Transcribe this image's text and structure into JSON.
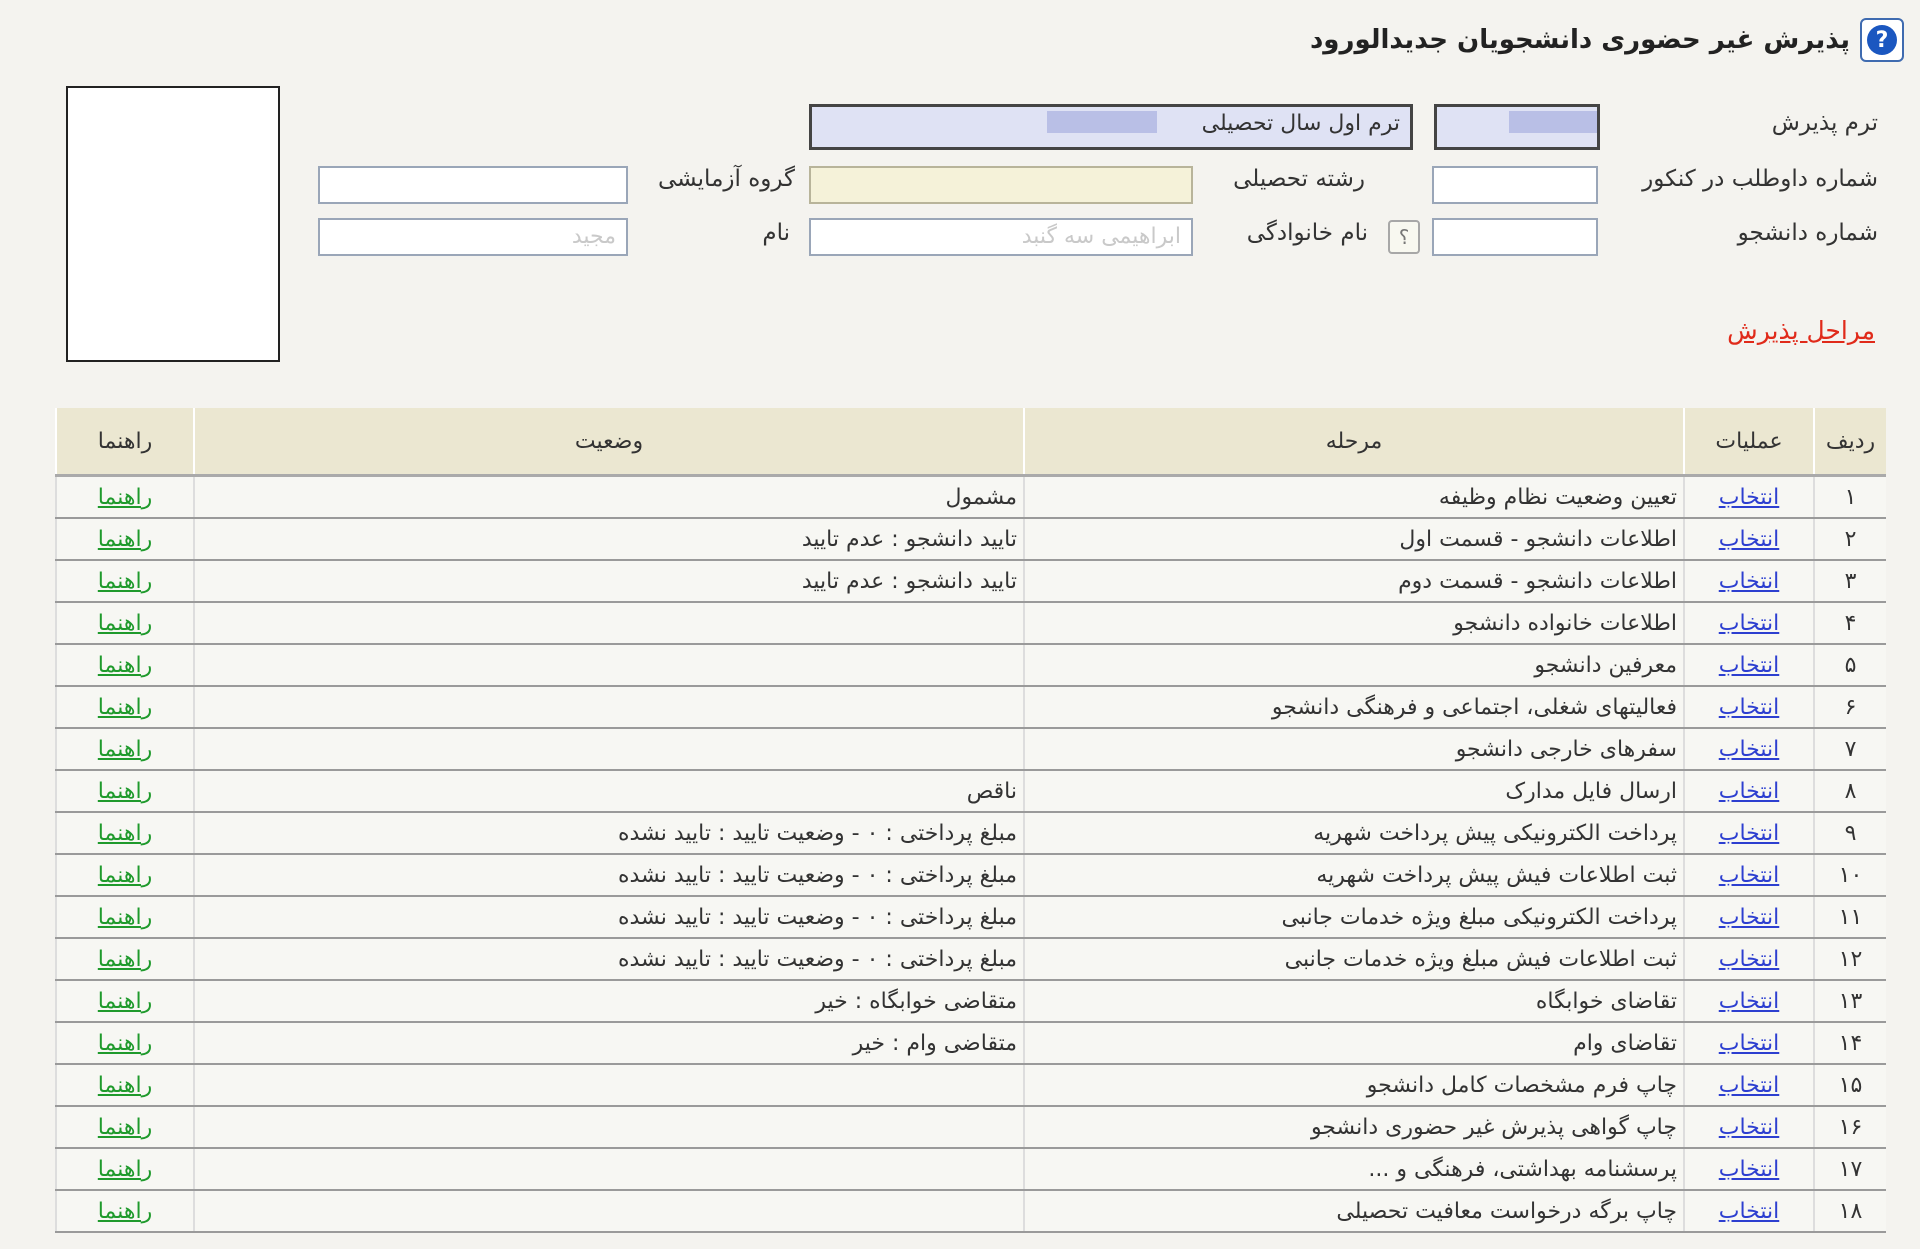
{
  "header": {
    "title": "پذیرش غیر حضوری دانشجویان جدیدالورود",
    "help_icon": "?"
  },
  "form": {
    "term_label": "ترم پذیرش",
    "term_value": "ترم اول سال تحصیلی",
    "entrance_label": "شماره داوطلب در کنکور",
    "major_label": "رشته تحصیلی",
    "group_label": "گروه آزمایشی",
    "student_no_label": "شماره دانشجو",
    "family_label": "نام خانوادگی",
    "family_value": "ابراهیمی سه گنبد",
    "name_label": "نام",
    "name_value": "مجید",
    "lookup_icon": "؟"
  },
  "steps_link": "مراحل پذیرش",
  "table": {
    "headers": {
      "row": "ردیف",
      "ops": "عملیات",
      "stage": "مرحله",
      "status": "وضعیت",
      "guide": "راهنما"
    },
    "rows": [
      {
        "num": "۱",
        "op": "انتخاب",
        "stage": "تعیین وضعیت نظام وظیفه",
        "status": "مشمول",
        "guide": "راهنما"
      },
      {
        "num": "۲",
        "op": "انتخاب",
        "stage": "اطلاعات دانشجو - قسمت اول",
        "status": "تایید دانشجو : عدم تایید",
        "guide": "راهنما"
      },
      {
        "num": "۳",
        "op": "انتخاب",
        "stage": "اطلاعات دانشجو - قسمت دوم",
        "status": "تایید دانشجو : عدم تایید",
        "guide": "راهنما"
      },
      {
        "num": "۴",
        "op": "انتخاب",
        "stage": "اطلاعات خانواده دانشجو",
        "status": "",
        "guide": "راهنما"
      },
      {
        "num": "۵",
        "op": "انتخاب",
        "stage": "معرفین دانشجو",
        "status": "",
        "guide": "راهنما"
      },
      {
        "num": "۶",
        "op": "انتخاب",
        "stage": "فعالیتهای شغلی، اجتماعی و فرهنگی دانشجو",
        "status": "",
        "guide": "راهنما"
      },
      {
        "num": "۷",
        "op": "انتخاب",
        "stage": "سفرهای خارجی دانشجو",
        "status": "",
        "guide": "راهنما"
      },
      {
        "num": "۸",
        "op": "انتخاب",
        "stage": "ارسال فایل مدارک",
        "status": "ناقص",
        "guide": "راهنما"
      },
      {
        "num": "۹",
        "op": "انتخاب",
        "stage": "پرداخت الکترونیکی پیش پرداخت شهریه",
        "status": "مبلغ پرداختی : ۰ - وضعیت تایید : تایید نشده",
        "guide": "راهنما"
      },
      {
        "num": "۱۰",
        "op": "انتخاب",
        "stage": "ثبت اطلاعات فیش پیش پرداخت شهریه",
        "status": "مبلغ پرداختی : ۰ - وضعیت تایید : تایید نشده",
        "guide": "راهنما"
      },
      {
        "num": "۱۱",
        "op": "انتخاب",
        "stage": "پرداخت الکترونیکی مبلغ ویژه خدمات جانبی",
        "status": "مبلغ پرداختی : ۰ - وضعیت تایید : تایید نشده",
        "guide": "راهنما"
      },
      {
        "num": "۱۲",
        "op": "انتخاب",
        "stage": "ثبت اطلاعات فیش مبلغ ویژه خدمات جانبی",
        "status": "مبلغ پرداختی : ۰ - وضعیت تایید : تایید نشده",
        "guide": "راهنما"
      },
      {
        "num": "۱۳",
        "op": "انتخاب",
        "stage": "تقاضای خوابگاه",
        "status": "متقاضی خوابگاه : خیر",
        "guide": "راهنما"
      },
      {
        "num": "۱۴",
        "op": "انتخاب",
        "stage": "تقاضای وام",
        "status": "متقاضی وام : خیر",
        "guide": "راهنما"
      },
      {
        "num": "۱۵",
        "op": "انتخاب",
        "stage": "چاپ فرم مشخصات کامل دانشجو",
        "status": "",
        "guide": "راهنما"
      },
      {
        "num": "۱۶",
        "op": "انتخاب",
        "stage": "چاپ گواهی پذیرش غیر حضوری دانشجو",
        "status": "",
        "guide": "راهنما"
      },
      {
        "num": "۱۷",
        "op": "انتخاب",
        "stage": "پرسشنامه بهداشتی، فرهنگی و ...",
        "status": "",
        "guide": "راهنما"
      },
      {
        "num": "۱۸",
        "op": "انتخاب",
        "stage": "چاپ برگه درخواست معافیت تحصیلی",
        "status": "",
        "guide": "راهنما"
      }
    ]
  }
}
